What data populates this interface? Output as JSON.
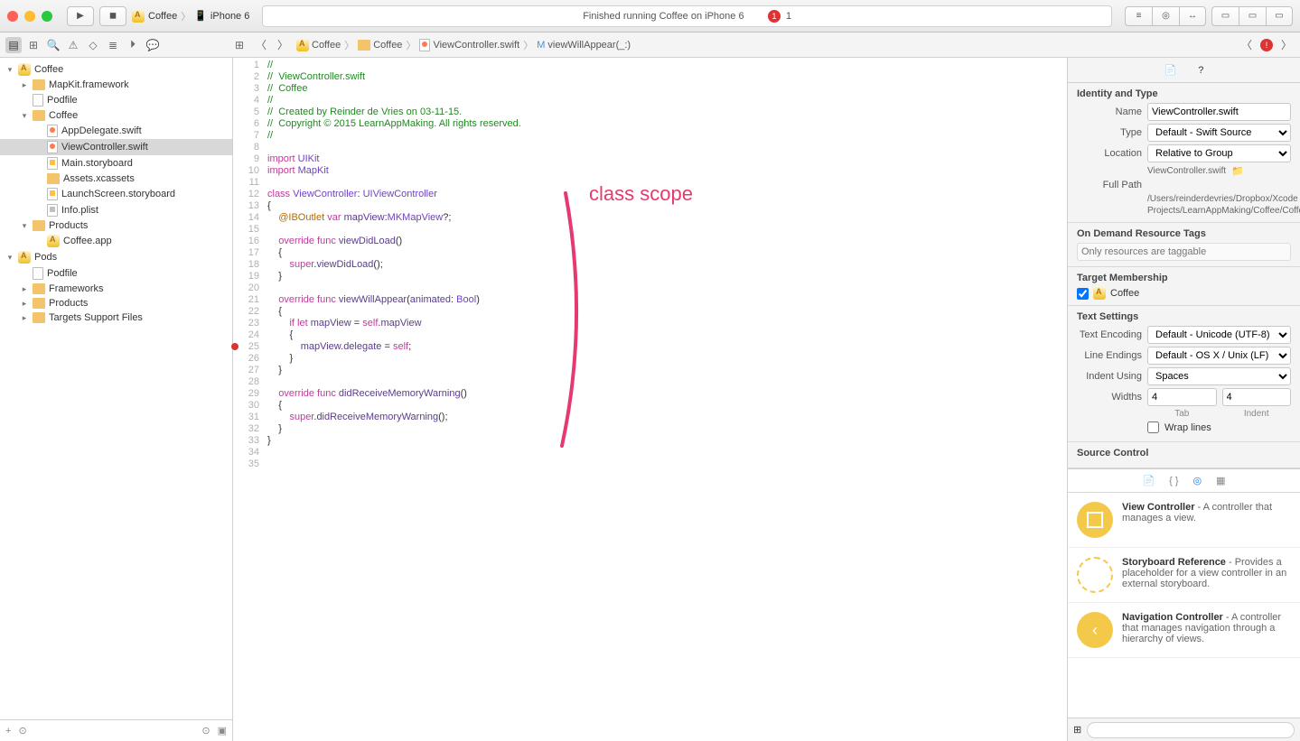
{
  "toolbar": {
    "scheme_app": "Coffee",
    "scheme_device": "iPhone 6",
    "status": "Finished running Coffee on iPhone 6",
    "error_count": "1"
  },
  "breadcrumb": {
    "items": [
      "Coffee",
      "Coffee",
      "ViewController.swift",
      "viewWillAppear(_:)"
    ]
  },
  "nav": [
    {
      "depth": 0,
      "disc": "▾",
      "icon": "app",
      "label": "Coffee"
    },
    {
      "depth": 1,
      "disc": "▸",
      "icon": "folder-yellow",
      "label": "MapKit.framework"
    },
    {
      "depth": 1,
      "disc": "",
      "icon": "file",
      "label": "Podfile"
    },
    {
      "depth": 1,
      "disc": "▾",
      "icon": "folder-yellow",
      "label": "Coffee"
    },
    {
      "depth": 2,
      "disc": "",
      "icon": "swift",
      "label": "AppDelegate.swift"
    },
    {
      "depth": 2,
      "disc": "",
      "icon": "swift",
      "label": "ViewController.swift",
      "sel": true
    },
    {
      "depth": 2,
      "disc": "",
      "icon": "sb",
      "label": "Main.storyboard"
    },
    {
      "depth": 2,
      "disc": "",
      "icon": "folder-yellow",
      "label": "Assets.xcassets"
    },
    {
      "depth": 2,
      "disc": "",
      "icon": "sb",
      "label": "LaunchScreen.storyboard"
    },
    {
      "depth": 2,
      "disc": "",
      "icon": "plist",
      "label": "Info.plist"
    },
    {
      "depth": 1,
      "disc": "▾",
      "icon": "folder-yellow",
      "label": "Products"
    },
    {
      "depth": 2,
      "disc": "",
      "icon": "app",
      "label": "Coffee.app"
    },
    {
      "depth": 0,
      "disc": "▾",
      "icon": "app",
      "label": "Pods"
    },
    {
      "depth": 1,
      "disc": "",
      "icon": "file",
      "label": "Podfile"
    },
    {
      "depth": 1,
      "disc": "▸",
      "icon": "folder-yellow",
      "label": "Frameworks"
    },
    {
      "depth": 1,
      "disc": "▸",
      "icon": "folder-yellow",
      "label": "Products"
    },
    {
      "depth": 1,
      "disc": "▸",
      "icon": "folder-yellow",
      "label": "Targets Support Files"
    }
  ],
  "code": {
    "lines": [
      "//",
      "//  ViewController.swift",
      "//  Coffee",
      "//",
      "//  Created by Reinder de Vries on 03-11-15.",
      "//  Copyright © 2015 LearnAppMaking. All rights reserved.",
      "//",
      "",
      "import UIKit",
      "import MapKit",
      "",
      "class ViewController: UIViewController",
      "{",
      "    @IBOutlet var mapView:MKMapView?;",
      "",
      "    override func viewDidLoad()",
      "    {",
      "        super.viewDidLoad();",
      "    }",
      "",
      "    override func viewWillAppear(animated: Bool)",
      "    {",
      "        if let mapView = self.mapView",
      "        {",
      "            mapView.delegate = self;",
      "        }",
      "    }",
      "",
      "    override func didReceiveMemoryWarning()",
      "    {",
      "        super.didReceiveMemoryWarning();",
      "    }",
      "}",
      "",
      ""
    ],
    "error_line": 25,
    "annotation": "class scope"
  },
  "inspector": {
    "identity": {
      "header": "Identity and Type",
      "name_label": "Name",
      "name_value": "ViewController.swift",
      "type_label": "Type",
      "type_value": "Default - Swift Source",
      "loc_label": "Location",
      "loc_value": "Relative to Group",
      "loc_file": "ViewController.swift",
      "path_label": "Full Path",
      "path_value": "/Users/reinderdevries/Dropbox/Xcode Projects/LearnAppMaking/Coffee/Coffee/ViewController.swift"
    },
    "ondemand": {
      "header": "On Demand Resource Tags",
      "placeholder": "Only resources are taggable"
    },
    "target": {
      "header": "Target Membership",
      "item": "Coffee"
    },
    "text": {
      "header": "Text Settings",
      "enc_label": "Text Encoding",
      "enc_value": "Default - Unicode (UTF-8)",
      "le_label": "Line Endings",
      "le_value": "Default - OS X / Unix (LF)",
      "indent_label": "Indent Using",
      "indent_value": "Spaces",
      "widths_label": "Widths",
      "tab": "4",
      "indent": "4",
      "tab_l": "Tab",
      "indent_l": "Indent",
      "wrap": "Wrap lines"
    },
    "src": {
      "header": "Source Control"
    },
    "library": [
      {
        "icon": "solid",
        "title": "View Controller",
        "desc": " - A controller that manages a view."
      },
      {
        "icon": "dashed",
        "title": "Storyboard Reference",
        "desc": " - Provides a placeholder for a view controller in an external storyboard."
      },
      {
        "icon": "nav",
        "title": "Navigation Controller",
        "desc": " - A controller that manages navigation through a hierarchy of views."
      }
    ]
  }
}
